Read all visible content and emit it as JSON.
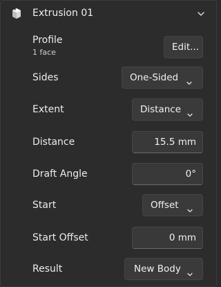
{
  "header": {
    "title": "Extrusion 01",
    "icon": "extrusion-feature-icon",
    "collapse_icon": "chevron-down-icon"
  },
  "profile": {
    "label": "Profile",
    "sublabel": "1 face",
    "button_label": "Edit..."
  },
  "sides": {
    "label": "Sides",
    "value": "One-Sided"
  },
  "extent": {
    "label": "Extent",
    "value": "Distance"
  },
  "distance": {
    "label": "Distance",
    "value": "15.5 mm"
  },
  "draft_angle": {
    "label": "Draft Angle",
    "value": "0°"
  },
  "start": {
    "label": "Start",
    "value": "Offset"
  },
  "start_offset": {
    "label": "Start Offset",
    "value": "0 mm"
  },
  "result": {
    "label": "Result",
    "value": "New Body"
  }
}
